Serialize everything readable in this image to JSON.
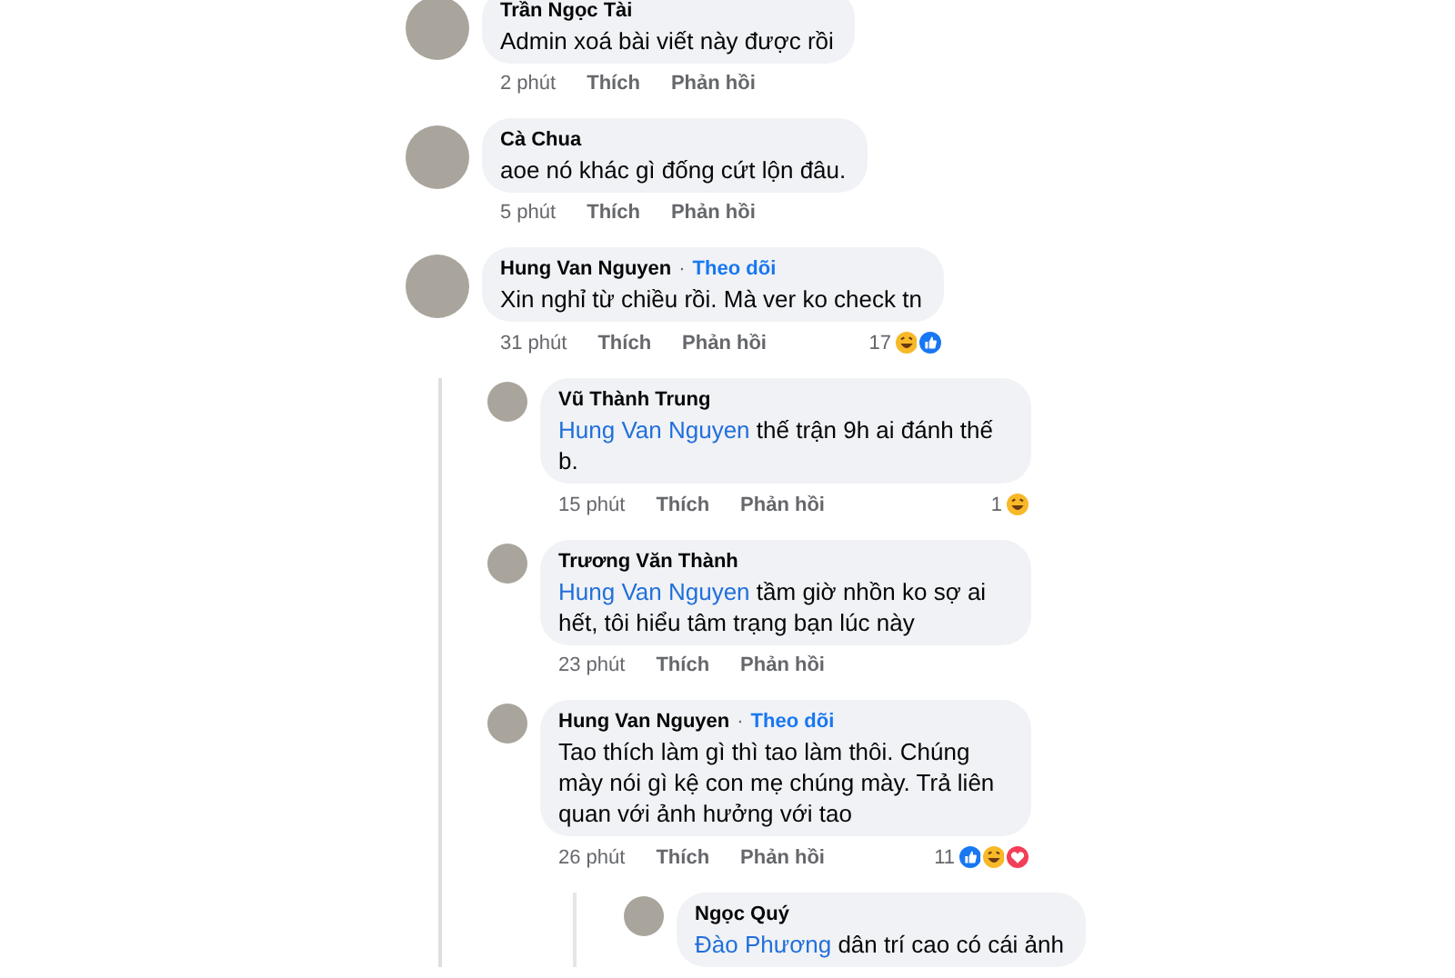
{
  "comments": [
    {
      "name": "Trần Ngọc Tài",
      "text": "Admin xoá bài viết này được rồi",
      "time": "2 phút",
      "like": "Thích",
      "reply": "Phản hồi"
    },
    {
      "name": "Cà Chua",
      "text": "aoe nó khác gì đống cứt lộn đâu.",
      "time": "5 phút",
      "like": "Thích",
      "reply": "Phản hồi"
    },
    {
      "name": "Hung Van Nguyen",
      "separator": "·",
      "follow": "Theo dõi",
      "text": "Xin nghỉ từ chiều rồi. Mà ver ko check tn",
      "time": "31 phút",
      "like": "Thích",
      "reply": "Phản hồi",
      "count": "17",
      "reactions": [
        {
          "kind": "haha"
        },
        {
          "kind": "like"
        }
      ],
      "children": [
        {
          "name": "Vũ Thành Trung",
          "mention": "Hung Van Nguyen",
          "text": "thế trận 9h ai đánh thế b.",
          "time": "15 phút",
          "like": "Thích",
          "reply": "Phản hồi",
          "count": "1",
          "reactions": [
            {
              "kind": "haha"
            }
          ]
        },
        {
          "name": "Trương Văn Thành",
          "mention": "Hung Van Nguyen",
          "text": "tầm giờ nhồn ko sợ ai hết, tôi hiểu tâm trạng bạn lúc này",
          "time": "23 phút",
          "like": "Thích",
          "reply": "Phản hồi"
        },
        {
          "name": "Hung Van Nguyen",
          "separator": "·",
          "follow": "Theo dõi",
          "text": "Tao thích làm gì thì tao làm thôi. Chúng mày nói gì kệ con mẹ chúng mày. Trả liên quan với ảnh hưởng với tao",
          "time": "26 phút",
          "like": "Thích",
          "reply": "Phản hồi",
          "count": "11",
          "reactions": [
            {
              "kind": "like"
            },
            {
              "kind": "haha"
            },
            {
              "kind": "love"
            }
          ],
          "children": [
            {
              "name": "Ngọc Quý",
              "mention": "Đào Phương",
              "text": "dân trí cao có cái ảnh"
            }
          ]
        }
      ]
    }
  ]
}
